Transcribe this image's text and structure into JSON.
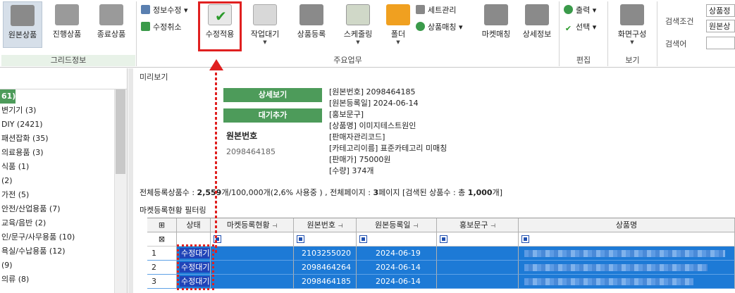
{
  "ribbon": {
    "buttons": [
      {
        "label": "원본상품"
      },
      {
        "label": "진행상품"
      },
      {
        "label": "종료상품"
      },
      {
        "label": "수정적용"
      },
      {
        "label": "작업대기"
      },
      {
        "label": "상품등록"
      },
      {
        "label": "스케줄링"
      },
      {
        "label": "폴더"
      },
      {
        "label": "마켓매칭"
      },
      {
        "label": "상세정보"
      },
      {
        "label": "화면구성"
      }
    ],
    "small": {
      "edit_info": "정보수정",
      "edit_cancel": "수정취소",
      "set_manage": "세트관리",
      "product_match": "상품매칭",
      "output": "출력",
      "select": "선택"
    },
    "groups": {
      "grid_info": "그리드정보",
      "main_work": "주요업무",
      "edit": "편집",
      "view": "보기"
    },
    "search": {
      "condition_label": "검색조건",
      "keyword_label": "검색어",
      "condition_value1": "상품정",
      "condition_value2": "원본상"
    },
    "colors": {
      "accent": "#4d9b5a",
      "group_bar": "#e8f2e8",
      "highlight": "#e02020"
    }
  },
  "tree": {
    "header_text": "",
    "items": [
      "61)",
      "변기기 (3)",
      "DIY (2421)",
      "패션잡화 (35)",
      "의료용품 (3)",
      "식품 (1)",
      "(2)",
      "가전 (5)",
      "안전/산업용품 (7)",
      "교육/음반 (2)",
      "인/문구/사무용품 (10)",
      "욕실/수납용품 (12)",
      "(9)",
      "의류 (8)"
    ]
  },
  "preview": {
    "title": "미리보기",
    "detail_button": "상세보기",
    "wait_add_button": "대기추가",
    "original_no_label": "원본번호",
    "original_no_value": "2098464185",
    "info_lines": [
      "[원본번호] 2098464185",
      "[원본등록일] 2024-06-14",
      "[홍보문구]",
      "[상품명] 이미지테스트원인",
      "[판매자관리코드]",
      "[카테고리이름] 표준카테고리 미매칭",
      "[판매가] 75000원",
      "[수량] 374개"
    ]
  },
  "summary": {
    "prefix": "전체등록상품수 : ",
    "count": "2,559",
    "rest": "개/100,000개(2,6% 사용중 ) , 전체페이지 : ",
    "pages": "3",
    "pages_suffix": "페이지 [검색된 상품수 : 총 ",
    "found": "1,000",
    "found_suffix": "개]"
  },
  "filter_label": "마켓등록현황 필터링",
  "grid": {
    "columns": [
      "상태",
      "마켓등록현황",
      "원본번호",
      "원본등록일",
      "홍보문구",
      "상품명"
    ],
    "rows": [
      {
        "num": "1",
        "status": "수정대기",
        "original_no": "2103255020",
        "date": "2024-06-19"
      },
      {
        "num": "2",
        "status": "수정대기",
        "original_no": "2098464264",
        "date": "2024-06-14"
      },
      {
        "num": "3",
        "status": "수정대기",
        "original_no": "2098464185",
        "date": "2024-06-14"
      }
    ]
  }
}
